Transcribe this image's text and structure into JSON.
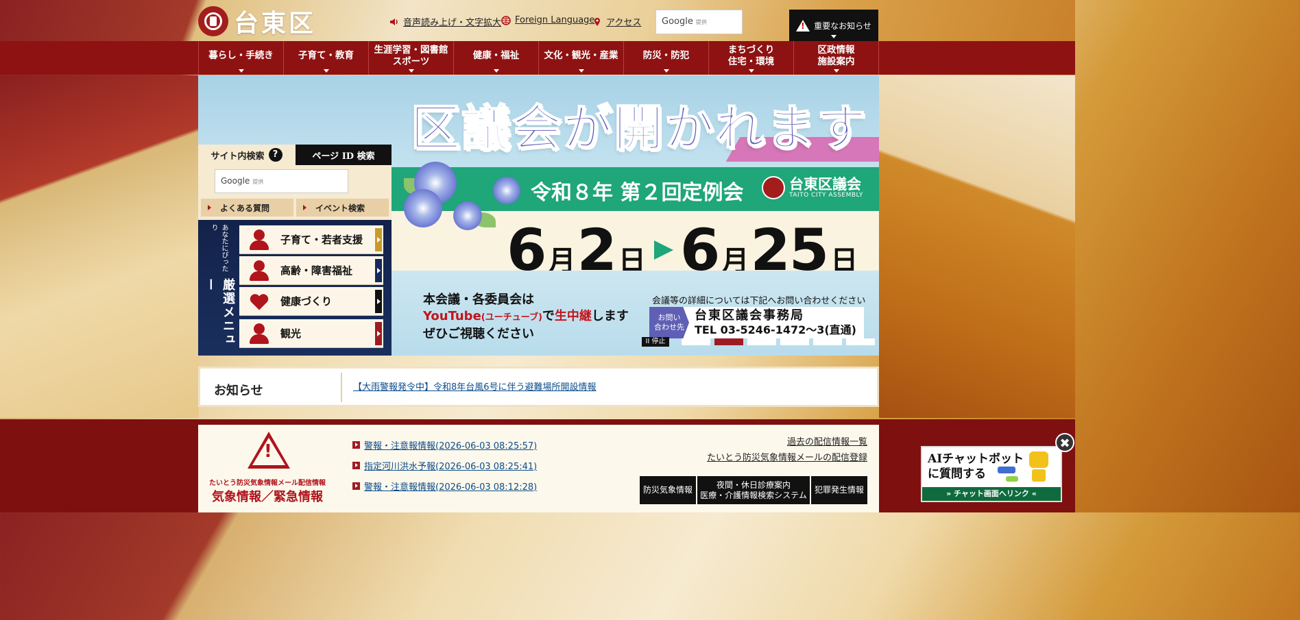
{
  "header": {
    "logo_text": "台東区",
    "utility_links": [
      {
        "label": "音声読み上げ・文字拡大",
        "icon": "speaker-icon"
      },
      {
        "label": "Foreign Language",
        "icon": "globe-icon"
      },
      {
        "label": "アクセス",
        "icon": "map-pin-icon"
      }
    ],
    "search_brand": "Google",
    "search_powered": "提供",
    "alert_label": "重要なお知らせ"
  },
  "nav": {
    "items": [
      {
        "label": "暮らし・手続き"
      },
      {
        "label": "子育て・教育"
      },
      {
        "label": "生涯学習・図書館\nスポーツ"
      },
      {
        "label": "健康・福祉"
      },
      {
        "label": "文化・観光・産業"
      },
      {
        "label": "防災・防犯"
      },
      {
        "label": "まちづくり\n住宅・環境"
      },
      {
        "label": "区政情報\n施設案内"
      }
    ]
  },
  "hero": {
    "title": "区議会が開かれます",
    "session": "令和８年 第２回定例会",
    "assembly_name": "台東区議会",
    "assembly_en": "TAITO CITY ASSEMBLY",
    "date_start_month": "6",
    "date_start_day": "2",
    "date_end_month": "6",
    "date_end_day": "25",
    "unit_month": "月",
    "unit_day": "日",
    "youtube_line1": "本会議・各委員会は",
    "youtube_word": "YouTube",
    "youtube_reading": "(ユーチューブ)",
    "youtube_mid": "で",
    "youtube_live": "生中継",
    "youtube_end": "します",
    "youtube_line3": "ぜひご視聴ください",
    "contact_note": "会議等の詳細については下記へお問い合わせください",
    "contact_tag": "お問い\n合わせ先",
    "contact_office": "台東区議会事務局",
    "contact_tel": "TEL 03-5246-1472～3(直通)",
    "pause_label": "II 停止",
    "slide_count": 6,
    "active_slide": 2
  },
  "site_search": {
    "tab_site": "サイト内検索",
    "tab_help": "?",
    "tab_pageid": "ページ ID 検索",
    "input_brand": "Google",
    "input_powered": "提供",
    "faq_label": "よくある質問",
    "event_label": "イベント検索"
  },
  "featured": {
    "vertical_small": "あなたにぴったり",
    "vertical_big": "厳選メニュー",
    "items": [
      {
        "label": "子育て・若者支援",
        "icon": "woman-icon",
        "arrow_color": "#c89a2e"
      },
      {
        "label": "高齢・障害福祉",
        "icon": "person-icon",
        "arrow_color": "#16295a"
      },
      {
        "label": "健康づくり",
        "icon": "heart-dumbbell-icon",
        "arrow_color": "#111111"
      },
      {
        "label": "観光",
        "icon": "camera-person-icon",
        "arrow_color": "#9e1b24"
      }
    ]
  },
  "notice": {
    "label": "お知らせ",
    "link": "【大雨警報発令中】令和8年台風6号に伴う避難場所開設情報"
  },
  "disaster": {
    "subtitle": "たいとう防災気象情報メール配信情報",
    "title": "気象情報／緊急情報",
    "items": [
      "警報・注意報情報(2026-06-03 08:25:57)",
      "指定河川洪水予報(2026-06-03 08:25:41)",
      "警報・注意報情報(2026-06-03 08:12:28)"
    ],
    "right_links": [
      "過去の配信情報一覧",
      "たいとう防災気象情報メールの配信登録"
    ],
    "buttons": [
      "防災気象情報",
      "夜間・休日診療案内\n医療・介護情報検索システム",
      "犯罪発生情報"
    ]
  },
  "chatbot": {
    "line1": "AIチャットボット",
    "line2": "に質問する",
    "footer": "» チャット画面へリンク «",
    "close": "✖"
  },
  "colors": {
    "brand_red": "#8e1212",
    "accent_green": "#1fa679",
    "hero_purple": "#5f5fb5",
    "link_blue": "#0d4c8a"
  }
}
